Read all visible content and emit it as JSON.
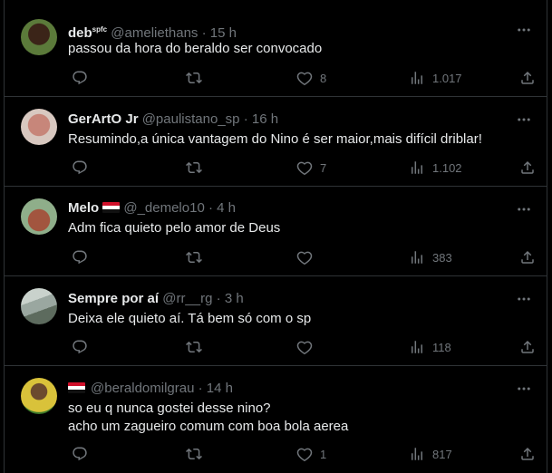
{
  "tweets": [
    {
      "name": "deb",
      "name_sup": "spfc",
      "handle": "@ameliethans",
      "sep": "·",
      "time": "15 h",
      "text": "passou da hora do beraldo ser convocado",
      "reply_count": "",
      "retweet_count": "",
      "like_count": "8",
      "view_count": "1.017",
      "avatar_colors": [
        "#5b7a3a",
        "#3b2418"
      ]
    },
    {
      "name": "GerArtO Jr",
      "handle": "@paulistano_sp",
      "sep": "·",
      "time": "16 h",
      "text": "Resumindo,a única vantagem do Nino é ser maior,mais difícil driblar!",
      "reply_count": "",
      "retweet_count": "",
      "like_count": "7",
      "view_count": "1.102",
      "avatar_colors": [
        "#d8c8c0",
        "#c7867a"
      ]
    },
    {
      "name": "Melo",
      "handle": "@_demelo10",
      "sep": "·",
      "time": "4 h",
      "text": "Adm fica quieto pelo amor de Deus",
      "reply_count": "",
      "retweet_count": "",
      "like_count": "",
      "view_count": "383",
      "avatar_colors": [
        "#8fae8a",
        "#a2553f"
      ]
    },
    {
      "name": "Sempre por aí",
      "handle": "@rr__rg",
      "sep": "·",
      "time": "3 h",
      "text": "Deixa ele quieto aí. Tá bem só com o sp",
      "reply_count": "",
      "retweet_count": "",
      "like_count": "",
      "view_count": "118",
      "avatar_colors": [
        "#9aa7a0",
        "#5d6b5e"
      ]
    },
    {
      "name": "",
      "handle": "@beraldomilgrau",
      "sep": "·",
      "time": "14 h",
      "text_lines": [
        "so eu q nunca gostei desse nino?",
        "acho um zagueiro comum com boa bola aerea"
      ],
      "reply_count": "",
      "retweet_count": "",
      "like_count": "1",
      "view_count": "817",
      "avatar_colors": [
        "#d9c23a",
        "#3d7a2a"
      ]
    }
  ],
  "icons": {
    "reply": "reply-icon",
    "retweet": "retweet-icon",
    "like": "like-icon",
    "views": "views-icon",
    "share": "share-icon",
    "more": "more-icon",
    "flag": "flag-icon"
  },
  "colors": {
    "background": "#000000",
    "text": "#e7e9ea",
    "muted": "#71767b",
    "border": "#2f3336"
  }
}
